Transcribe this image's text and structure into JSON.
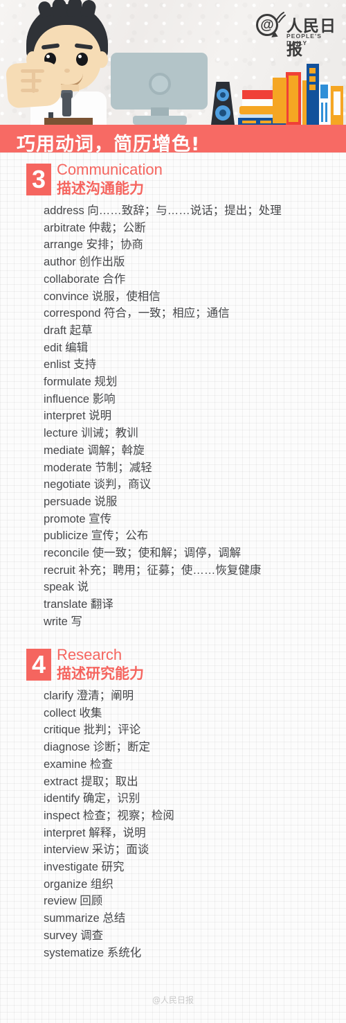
{
  "header": {
    "logo": {
      "at_symbol": "@",
      "chinese": "人民日报",
      "english": "PEOPLE'S DAILY"
    }
  },
  "banner": {
    "title": "巧用动词，简历增色!",
    "color": "#f76a64"
  },
  "accent_color": "#f5655f",
  "sections": [
    {
      "number": "3",
      "title_en": "Communication",
      "title_cn": "描述沟通能力",
      "items": [
        "address 向……致辞；与……说话；提出；处理",
        "arbitrate 仲裁；公断",
        "arrange  安排；协商",
        "author 创作出版",
        "collaborate 合作",
        "convince 说服，使相信",
        "correspond 符合，一致；相应；通信",
        "draft 起草",
        "edit 编辑",
        "enlist 支持",
        "formulate 规划",
        "influence 影响",
        "interpret 说明",
        "lecture 训诫；教训",
        "mediate  调解；斡旋",
        "moderate 节制；减轻",
        "negotiate 谈判，商议",
        "persuade 说服",
        "promote 宣传",
        "publicize 宣传；公布",
        "reconcile 使一致；使和解；调停，调解",
        "recruit 补充；聘用；征募；使……恢复健康",
        "speak 说",
        "translate 翻译",
        "write 写"
      ]
    },
    {
      "number": "4",
      "title_en": "Research",
      "title_cn": "描述研究能力",
      "items": [
        "clarify 澄清；阐明",
        "collect  收集",
        "critique  批判；评论",
        "diagnose  诊断；断定",
        "examine 检查",
        "extract 提取；取出",
        "identify 确定，识别",
        "inspect  检查；视察；检阅",
        "interpret 解释，说明",
        "interview 采访；面谈",
        "investigate 研究",
        "organize 组织",
        "review 回顾",
        "summarize 总结",
        "survey 调查",
        "systematize 系统化"
      ]
    }
  ],
  "footer": {
    "watermark": "@人民日报"
  }
}
